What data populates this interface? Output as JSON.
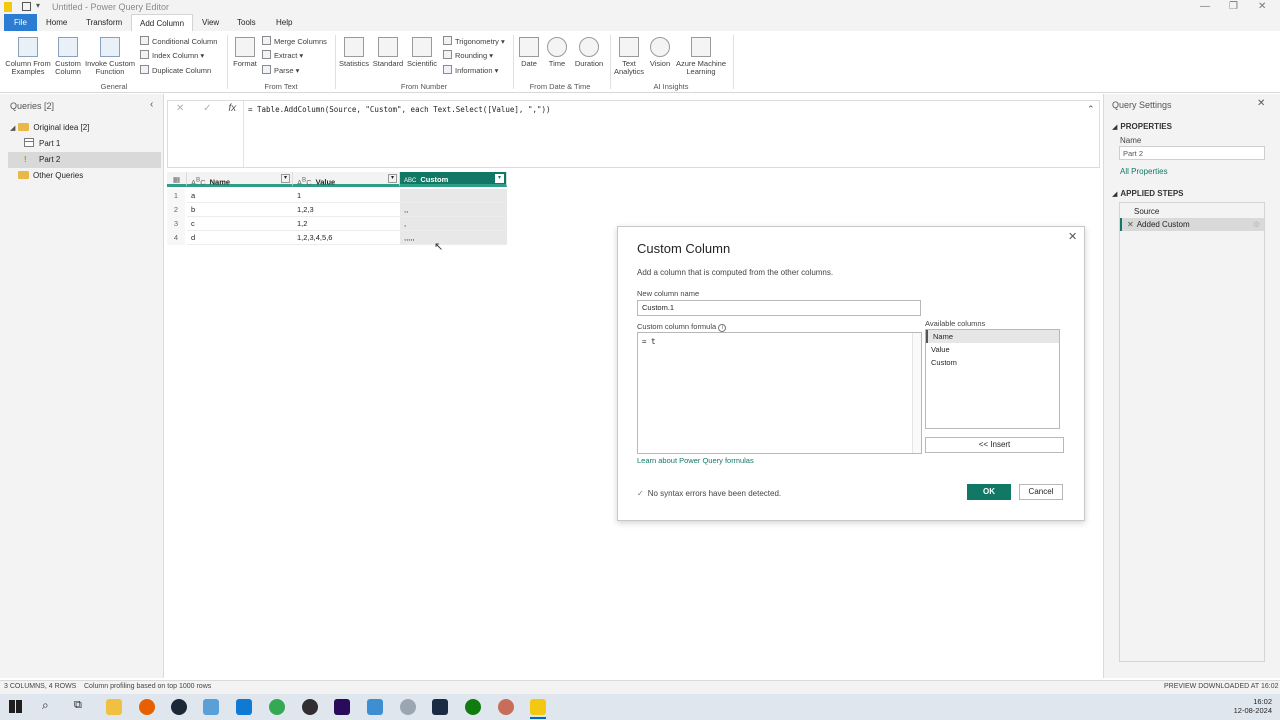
{
  "window": {
    "title": "Untitled - Power Query Editor"
  },
  "menu": {
    "tabs": [
      "File",
      "Home",
      "Transform",
      "Add Column",
      "View",
      "Tools",
      "Help"
    ],
    "active": "Add Column"
  },
  "ribbon": {
    "general": {
      "label": "General",
      "column_from_examples": "Column From Examples",
      "custom_column": "Custom Column",
      "invoke_custom_function": "Invoke Custom Function",
      "conditional_column": "Conditional Column",
      "index_column": "Index Column",
      "duplicate_column": "Duplicate Column"
    },
    "from_text": {
      "label": "From Text",
      "format": "Format",
      "merge_columns": "Merge Columns",
      "extract": "Extract",
      "parse": "Parse"
    },
    "from_number": {
      "label": "From Number",
      "statistics": "Statistics",
      "standard": "Standard",
      "scientific": "Scientific",
      "trigonometry": "Trigonometry",
      "rounding": "Rounding",
      "information": "Information"
    },
    "from_date_time": {
      "label": "From Date & Time",
      "date": "Date",
      "time": "Time",
      "duration": "Duration"
    },
    "ai_insights": {
      "label": "AI Insights",
      "text_analytics": "Text Analytics",
      "vision": "Vision",
      "azure_ml": "Azure Machine Learning"
    }
  },
  "queries": {
    "header": "Queries [2]",
    "items": [
      {
        "label": "Original idea [2]",
        "type": "folder"
      },
      {
        "label": "Part 1",
        "type": "table"
      },
      {
        "label": "Part 2",
        "type": "table-warning",
        "selected": true
      },
      {
        "label": "Other Queries",
        "type": "folder"
      }
    ]
  },
  "formula_bar": {
    "text": "= Table.AddColumn(Source, \"Custom\", each Text.Select([Value], \",\"))"
  },
  "grid": {
    "columns": [
      {
        "name": "Name",
        "type": "ABC"
      },
      {
        "name": "Value",
        "type": "ABC"
      },
      {
        "name": "Custom",
        "type": "ABC123"
      }
    ],
    "rows": [
      {
        "n": "1",
        "name": "a",
        "value": "1",
        "custom": ""
      },
      {
        "n": "2",
        "name": "b",
        "value": "1,2,3",
        "custom": ",,"
      },
      {
        "n": "3",
        "name": "c",
        "value": "1,2",
        "custom": ","
      },
      {
        "n": "4",
        "name": "d",
        "value": "1,2,3,4,5,6",
        "custom": ",,,,,"
      }
    ]
  },
  "query_settings": {
    "title": "Query Settings",
    "properties_header": "PROPERTIES",
    "name_label": "Name",
    "name_value": "Part 2",
    "all_properties": "All Properties",
    "applied_steps_header": "APPLIED STEPS",
    "steps": [
      "Source",
      "Added Custom"
    ]
  },
  "dialog": {
    "title": "Custom Column",
    "description": "Add a column that is computed from the other columns.",
    "new_column_label": "New column name",
    "new_column_value": "Custom.1",
    "formula_label": "Custom column formula",
    "formula_value": "= t",
    "available_label": "Available columns",
    "available": [
      "Name",
      "Value",
      "Custom"
    ],
    "insert_label": "<< Insert",
    "learn_link": "Learn about Power Query formulas",
    "syntax_status": "No syntax errors have been detected.",
    "ok_label": "OK",
    "cancel_label": "Cancel"
  },
  "status": {
    "left": "3 COLUMNS, 4 ROWS",
    "profiling": "Column profiling based on top 1000 rows",
    "right": "PREVIEW DOWNLOADED AT 16:02"
  },
  "taskbar": {
    "time": "16:02",
    "date": "12-08-2024"
  },
  "colors": {
    "accent_green": "#117865",
    "header_teal": "#2e9e86",
    "file_tab": "#2b7cd3",
    "link": "#117865"
  }
}
